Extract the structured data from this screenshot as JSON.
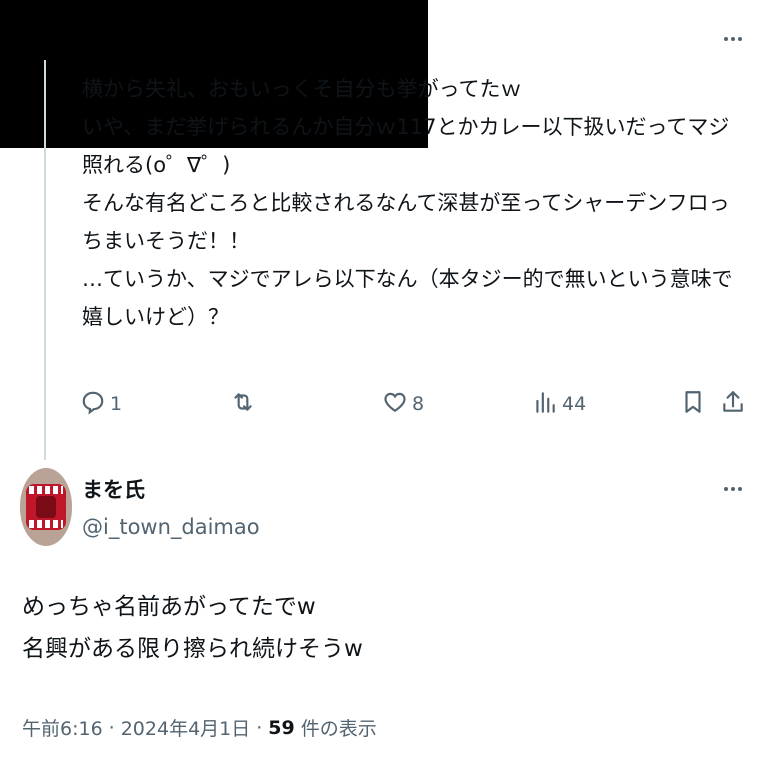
{
  "tweet1": {
    "lines": [
      "横から失礼、おもいっくそ自分も挙がってたｗ",
      "いや、まだ挙げられるんか自分ｗ117とかカレー以下扱いだってマジ照れる(o゜∇゜)",
      "そんな有名どころと比較されるなんて深甚が至ってシャーデンフロっちまいそうだ！！",
      "",
      "…ていうか、マジでアレら以下なん（本タジー的で無いという意味で嬉しいけど）？"
    ],
    "replies": "1",
    "retweets": "",
    "likes": "8",
    "views": "44"
  },
  "tweet2": {
    "display_name": "まを氏",
    "handle": "@i_town_daimao",
    "lines": [
      "めっちゃ名前あがってたでw",
      "名興がある限り擦られ続けそうw"
    ],
    "time": "午前6:16",
    "date": "2024年4月1日",
    "views_count": "59",
    "views_label": "件の表示"
  },
  "icons": {
    "reply": "reply-icon",
    "retweet": "retweet-icon",
    "like": "heart-icon",
    "views": "views-icon",
    "bookmark": "bookmark-icon",
    "share": "share-icon",
    "more": "more-icon"
  },
  "colors": {
    "text": "#0f1419",
    "muted": "#536471",
    "thread_line": "#cfd9de",
    "redaction": "#000000"
  }
}
